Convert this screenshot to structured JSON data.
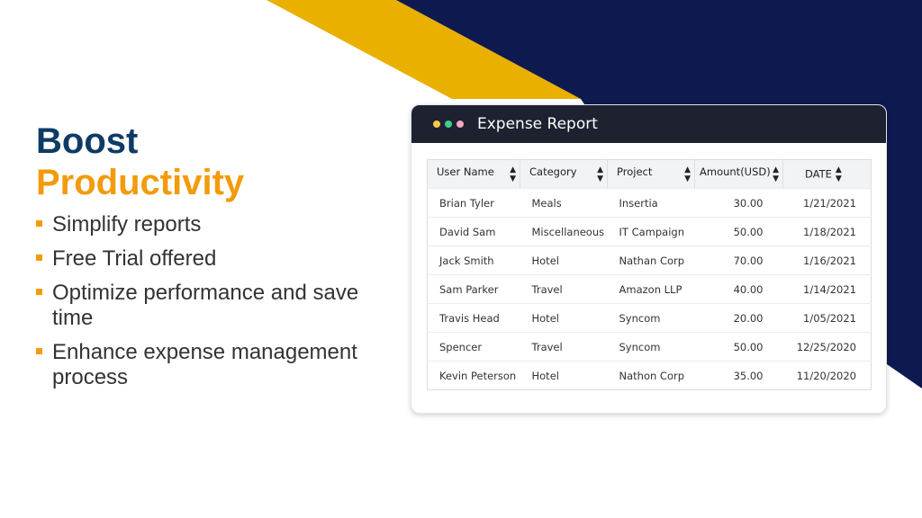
{
  "colors": {
    "navy": "#0e1a4f",
    "gold": "#e9b000",
    "headline_blue": "#0d3b66",
    "headline_orange": "#f29b0c",
    "window_titlebar": "#1e2230",
    "dot_yellow": "#f7c948",
    "dot_green": "#3ecf8e",
    "dot_pink": "#f6a5c0"
  },
  "headline": {
    "line1": "Boost",
    "line2": "Productivity"
  },
  "bullets": [
    "Simplify reports",
    "Free Trial offered",
    "Optimize performance and save time",
    "Enhance expense management process"
  ],
  "window": {
    "title": "Expense Report",
    "columns": [
      "User Name",
      "Category",
      "Project",
      "Amount(USD)",
      "DATE"
    ],
    "rows": [
      [
        "Brian Tyler",
        "Meals",
        "Insertia",
        "30.00",
        "1/21/2021"
      ],
      [
        "David Sam",
        "Miscellaneous",
        "IT Campaign",
        "50.00",
        "1/18/2021"
      ],
      [
        "Jack Smith",
        "Hotel",
        "Nathan Corp",
        "70.00",
        "1/16/2021"
      ],
      [
        "Sam Parker",
        "Travel",
        "Amazon LLP",
        "40.00",
        "1/14/2021"
      ],
      [
        "Travis Head",
        "Hotel",
        "Syncom",
        "20.00",
        "1/05/2021"
      ],
      [
        "Spencer",
        "Travel",
        "Syncom",
        "50.00",
        "12/25/2020"
      ],
      [
        "Kevin Peterson",
        "Hotel",
        "Nathon Corp",
        "35.00",
        "11/20/2020"
      ]
    ]
  },
  "icons": {
    "sort": "sort-arrows-icon"
  }
}
